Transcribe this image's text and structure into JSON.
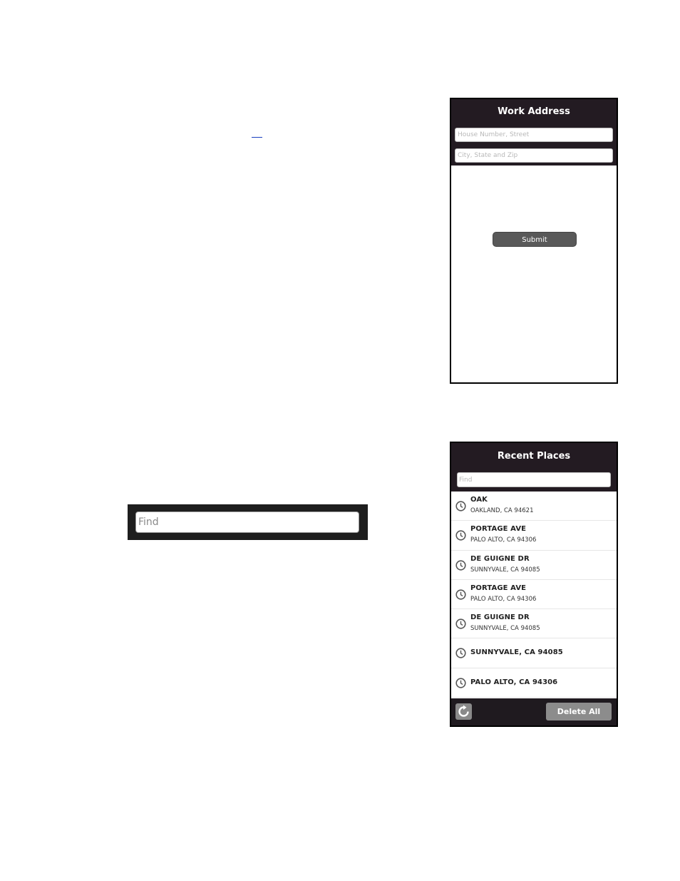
{
  "work_address": {
    "title": "Work Address",
    "street_placeholder": "House Number, Street",
    "city_placeholder": "City, State and Zip",
    "submit_label": "Submit"
  },
  "find_bar": {
    "placeholder": "Find"
  },
  "recent_places": {
    "title": "Recent Places",
    "find_placeholder": "Find",
    "items": [
      {
        "name": "OAK",
        "sub": "OAKLAND, CA 94621"
      },
      {
        "name": "PORTAGE AVE",
        "sub": "PALO ALTO, CA 94306"
      },
      {
        "name": "DE GUIGNE DR",
        "sub": "SUNNYVALE, CA 94085"
      },
      {
        "name": "PORTAGE AVE",
        "sub": "PALO ALTO, CA 94306"
      },
      {
        "name": "DE GUIGNE DR",
        "sub": "SUNNYVALE, CA 94085"
      },
      {
        "name": "SUNNYVALE, CA 94085",
        "sub": ""
      },
      {
        "name": "PALO ALTO, CA 94306",
        "sub": ""
      }
    ],
    "delete_all_label": "Delete All",
    "item_icon": "clock-icon",
    "refresh_icon": "refresh-icon"
  },
  "colors": {
    "header_bg": "#231b22",
    "button_gray": "#595959",
    "link_blue": "#1a3fbf"
  }
}
